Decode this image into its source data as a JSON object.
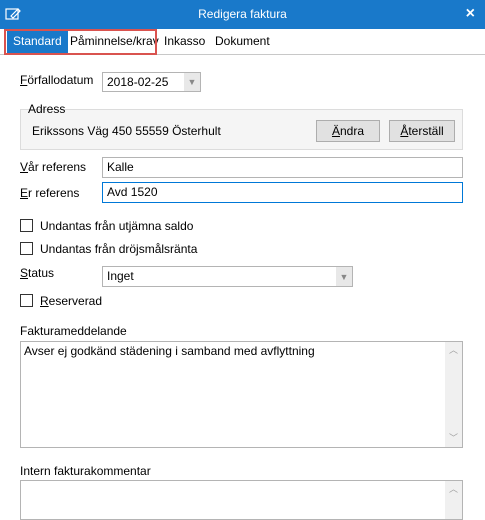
{
  "window": {
    "title": "Redigera faktura",
    "close_glyph": "×"
  },
  "tabs": [
    {
      "label": "Standard"
    },
    {
      "label": "Påminnelse/krav"
    },
    {
      "label": "Inkasso"
    },
    {
      "label": "Dokument"
    }
  ],
  "form": {
    "due_date": {
      "label_first": "F",
      "label_rest": "örfallodatum",
      "value": "2018-02-25"
    },
    "address": {
      "group_title": "Adress",
      "text": "Erikssons Väg 450 55559 Österhult",
      "change_btn_first": "Ä",
      "change_btn_rest": "ndra",
      "reset_btn_first": "Å",
      "reset_btn_rest": "terställ"
    },
    "our_reference": {
      "label_first": "V",
      "label_rest": "år referens",
      "value": "Kalle"
    },
    "your_reference": {
      "label_first": "E",
      "label_rest": "r referens",
      "value": "Avd 1520"
    },
    "exempt_balance": {
      "label": "Undantas från utjämna saldo",
      "checked": false
    },
    "exempt_interest": {
      "label": "Undantas från dröjsmålsränta",
      "checked": false
    },
    "status": {
      "label_first": "S",
      "label_rest": "tatus",
      "value": "Inget"
    },
    "reserved": {
      "label_first": "R",
      "label_rest": "eserverad",
      "checked": false
    },
    "invoice_message": {
      "label": "Fakturameddelande",
      "value": "Avser ej godkänd städening i samband med avflyttning"
    },
    "internal_comment": {
      "label": "Intern fakturakommentar",
      "value": ""
    }
  },
  "colors": {
    "accent": "#1979ca",
    "highlight": "#d9534f"
  }
}
